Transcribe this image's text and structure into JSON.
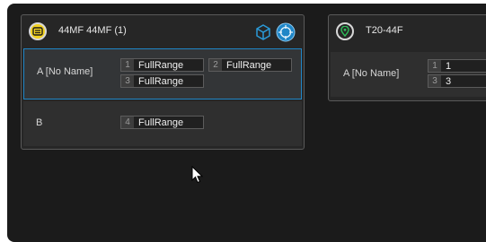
{
  "colors": {
    "accent": "#1f86c7",
    "device_yellow": "#f2d21f",
    "location_green": "#2fbf5a"
  },
  "device_a": {
    "title": "44MF  44MF (1)",
    "icon": "speaker-device-icon",
    "rows": [
      {
        "label": "A [No Name]",
        "selected": true,
        "channels": [
          {
            "num": "1",
            "value": "FullRange"
          },
          {
            "num": "2",
            "value": "FullRange"
          },
          {
            "num": "3",
            "value": "FullRange"
          }
        ]
      },
      {
        "label": "B",
        "selected": false,
        "channels": [
          {
            "num": "4",
            "value": "FullRange"
          }
        ]
      }
    ]
  },
  "device_b": {
    "title": "T20-44F",
    "icon": "location-pin-icon",
    "rows": [
      {
        "label": "A [No Name]",
        "channels": [
          {
            "num": "1",
            "value": "1"
          },
          {
            "num": "3",
            "value": "3"
          }
        ]
      }
    ]
  }
}
